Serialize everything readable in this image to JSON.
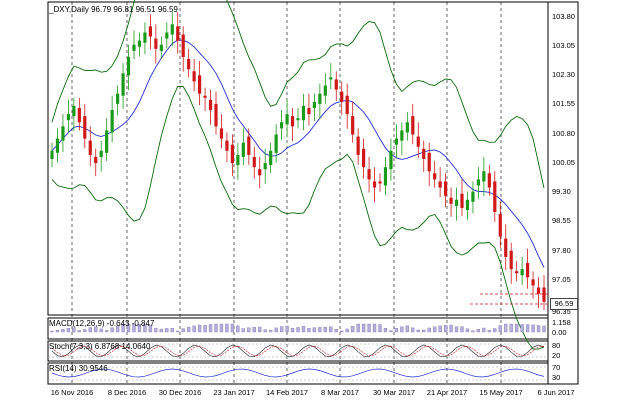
{
  "chart_title": "_DXY,Daily  96.79 96.81 96.51 96.59",
  "price_axis": [
    "103.80",
    "103.05",
    "102.30",
    "101.55",
    "100.80",
    "100.05",
    "99.30",
    "98.55",
    "97.80",
    "97.05",
    "96.35"
  ],
  "current_price": "96.59",
  "indicators": {
    "macd": {
      "label": "MACD(12,26,9) -0.643 -0.847",
      "scale": [
        "1.158",
        "0.00"
      ]
    },
    "stoch": {
      "label": "Stoch(7,3,3) 6.8768 14.0640",
      "scale": [
        "80",
        "20"
      ]
    },
    "rsi": {
      "label": "RSI(14) 30.9546",
      "scale": [
        "70",
        "30"
      ]
    }
  },
  "dates": [
    "16 Nov 2016",
    "8 Dec 2016",
    "30 Dec 2016",
    "23 Jan 2017",
    "14 Feb 2017",
    "8 Mar 2017",
    "30 Mar 2017",
    "21 Apr 2017",
    "15 May 2017",
    "6 Jun 2017"
  ],
  "colors": {
    "bull": "#1a9a1a",
    "bear": "#d01818",
    "bands": "#0a6a0a",
    "mid": "#2030d0",
    "grid": "#000000"
  },
  "chart_data": {
    "type": "candlestick",
    "y_range": [
      96.35,
      103.8
    ],
    "x_labels": [
      "16 Nov 2016",
      "8 Dec 2016",
      "30 Dec 2016",
      "23 Jan 2017",
      "14 Feb 2017",
      "8 Mar 2017",
      "30 Mar 2017",
      "21 Apr 2017",
      "15 May 2017",
      "6 Jun 2017"
    ],
    "last_bar": {
      "open": 96.79,
      "high": 96.81,
      "low": 96.51,
      "close": 96.59
    },
    "closes": [
      100.3,
      100.6,
      100.9,
      101.2,
      101.4,
      101.0,
      100.6,
      100.2,
      100.0,
      100.3,
      100.8,
      101.3,
      101.7,
      102.2,
      102.6,
      102.9,
      103.0,
      103.2,
      103.1,
      102.8,
      102.9,
      103.2,
      103.4,
      103.0,
      102.6,
      102.3,
      102.0,
      101.7,
      101.6,
      101.3,
      100.9,
      100.6,
      100.3,
      100.0,
      100.2,
      100.5,
      100.2,
      99.9,
      99.7,
      100.0,
      100.3,
      100.7,
      101.0,
      101.2,
      100.9,
      101.1,
      101.4,
      101.2,
      101.5,
      101.7,
      101.9,
      102.1,
      101.8,
      101.5,
      101.2,
      100.7,
      100.2,
      99.9,
      99.6,
      99.4,
      99.5,
      99.9,
      100.3,
      100.6,
      100.8,
      101.0,
      100.7,
      100.4,
      100.1,
      99.8,
      99.6,
      99.4,
      99.2,
      99.0,
      99.1,
      98.9,
      99.1,
      99.3,
      99.6,
      99.8,
      99.4,
      98.8,
      98.2,
      97.7,
      97.4,
      97.3,
      97.4,
      97.2,
      97.0,
      96.8,
      96.6
    ]
  }
}
